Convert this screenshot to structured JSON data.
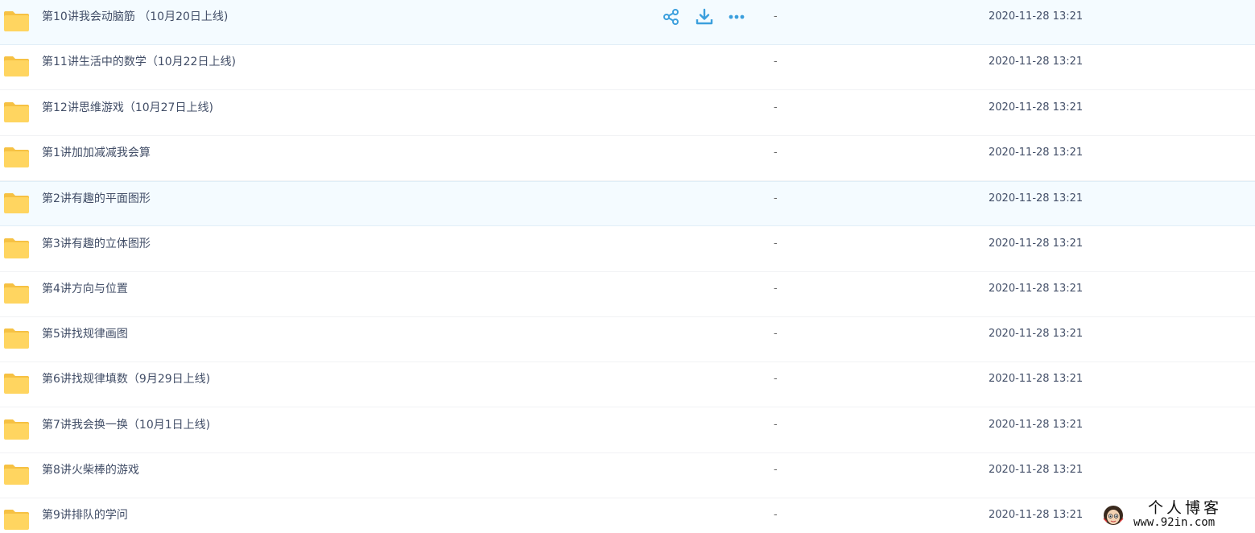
{
  "colors": {
    "folder": "#ffd560",
    "folder_tab": "#f6c143",
    "action_icon": "#3b9fdd",
    "row_highlight": "#f4fbff"
  },
  "row_actions": {
    "share_icon": "share-icon",
    "download_icon": "download-icon",
    "more_icon": "more-icon"
  },
  "files": [
    {
      "name": "第10讲我会动脑筋 （10月20日上线)",
      "size": "-",
      "modified": "2020-11-28 13:21",
      "state": "hover"
    },
    {
      "name": "第11讲生活中的数学（10月22日上线)",
      "size": "-",
      "modified": "2020-11-28 13:21",
      "state": ""
    },
    {
      "name": "第12讲思维游戏（10月27日上线)",
      "size": "-",
      "modified": "2020-11-28 13:21",
      "state": ""
    },
    {
      "name": "第1讲加加减减我会算",
      "size": "-",
      "modified": "2020-11-28 13:21",
      "state": ""
    },
    {
      "name": "第2讲有趣的平面图形",
      "size": "-",
      "modified": "2020-11-28 13:21",
      "state": "selected"
    },
    {
      "name": "第3讲有趣的立体图形",
      "size": "-",
      "modified": "2020-11-28 13:21",
      "state": ""
    },
    {
      "name": "第4讲方向与位置",
      "size": "-",
      "modified": "2020-11-28 13:21",
      "state": ""
    },
    {
      "name": "第5讲找规律画图",
      "size": "-",
      "modified": "2020-11-28 13:21",
      "state": ""
    },
    {
      "name": "第6讲找规律填数（9月29日上线)",
      "size": "-",
      "modified": "2020-11-28 13:21",
      "state": ""
    },
    {
      "name": "第7讲我会换一换（10月1日上线)",
      "size": "-",
      "modified": "2020-11-28 13:21",
      "state": ""
    },
    {
      "name": "第8讲火柴棒的游戏",
      "size": "-",
      "modified": "2020-11-28 13:21",
      "state": ""
    },
    {
      "name": "第9讲排队的学问",
      "size": "-",
      "modified": "2020-11-28 13:21",
      "state": ""
    }
  ],
  "watermark": {
    "title": "个人博客",
    "url": "www.92in.com"
  }
}
